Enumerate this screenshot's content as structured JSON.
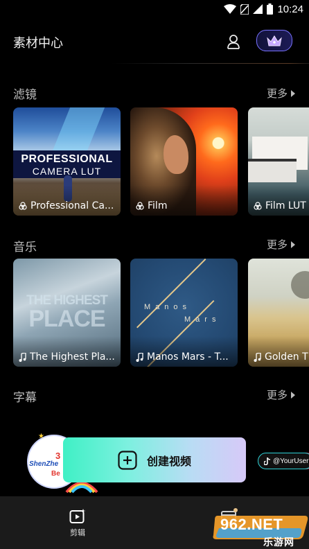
{
  "status_bar": {
    "time": "10:24",
    "icons": [
      "wifi-icon",
      "no-sim-icon",
      "signal-icon",
      "battery-icon"
    ]
  },
  "header": {
    "title": "素材中心",
    "user_icon": "user-icon",
    "vip_icon": "crown-icon"
  },
  "sections": {
    "filters": {
      "title": "滤镜",
      "more": "更多",
      "cards": [
        {
          "label": "Professional Ca...",
          "icon": "filter-icon",
          "art_title": "PROFESSIONAL",
          "art_sub": "CAMERA LUT"
        },
        {
          "label": "Film",
          "icon": "filter-icon"
        },
        {
          "label": "Film LUT",
          "icon": "filter-icon"
        }
      ]
    },
    "music": {
      "title": "音乐",
      "more": "更多",
      "cards": [
        {
          "label": "The Highest Pla...",
          "icon": "music-note-icon",
          "art_line1": "THE HIGHEST",
          "art_line2": "PLACE"
        },
        {
          "label": "Manos Mars - T...",
          "icon": "music-note-icon",
          "art_line1": "Manos",
          "art_line2": "Mars"
        },
        {
          "label": "Golden T",
          "icon": "music-note-icon"
        }
      ]
    },
    "subtitles": {
      "title": "字幕",
      "more": "更多",
      "left_banner_text1": "3",
      "left_banner_text2": "ShenZhe",
      "left_banner_text3": "Be",
      "right_banner_text": "@YourUser"
    }
  },
  "create_button": {
    "label": "创建视频",
    "icon": "plus-icon"
  },
  "bottom_nav": {
    "edit_label": "剪辑",
    "edit_icon": "video-edit-icon",
    "right_icon": "template-icon"
  },
  "watermark": {
    "brand": "962.NET",
    "sub": "乐游网"
  },
  "colors": {
    "accent_vip_border": "#7a73ff",
    "create_gradient_start": "#3ff0c5",
    "create_gradient_end": "#d7c9f8",
    "nav_bg": "#1b1b1b"
  }
}
